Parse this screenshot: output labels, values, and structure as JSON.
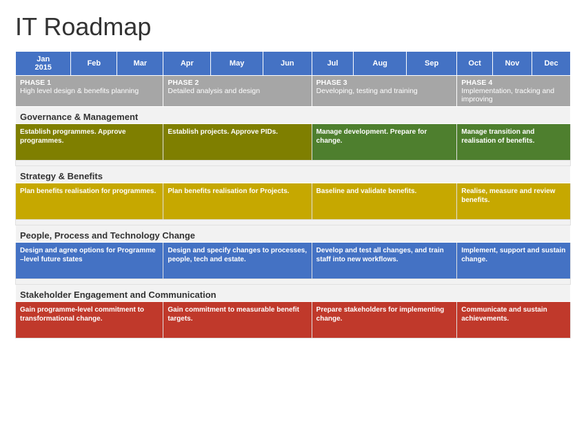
{
  "title": "IT Roadmap",
  "header": {
    "columns": [
      {
        "label": "Jan\n2015",
        "span": 1
      },
      {
        "label": "Feb",
        "span": 1
      },
      {
        "label": "Mar",
        "span": 1
      },
      {
        "label": "Apr",
        "span": 1
      },
      {
        "label": "May",
        "span": 1
      },
      {
        "label": "Jun",
        "span": 1
      },
      {
        "label": "Jul",
        "span": 1
      },
      {
        "label": "Aug",
        "span": 1
      },
      {
        "label": "Sep",
        "span": 1
      },
      {
        "label": "Oct",
        "span": 1
      },
      {
        "label": "Nov",
        "span": 1
      },
      {
        "label": "Dec",
        "span": 1
      }
    ]
  },
  "phases": [
    {
      "title": "PHASE 1",
      "desc": "High level design & benefits planning",
      "col_start": 1,
      "col_span": 3
    },
    {
      "title": "PHASE 2",
      "desc": "Detailed analysis and design",
      "col_start": 4,
      "col_span": 3
    },
    {
      "title": "PHASE 3",
      "desc": "Developing, testing and training",
      "col_start": 7,
      "col_span": 3
    },
    {
      "title": "PHASE 4",
      "desc": "Implementation, tracking and improving",
      "col_start": 10,
      "col_span": 3
    }
  ],
  "sections": [
    {
      "name": "Governance & Management",
      "tasks": [
        {
          "text": "Establish programmes. Approve programmes.",
          "color": "olive",
          "col_start": 1,
          "col_span": 3
        },
        {
          "text": "Establish projects. Approve PIDs.",
          "color": "olive",
          "col_start": 4,
          "col_span": 3
        },
        {
          "text": "Manage development. Prepare for change.",
          "color": "green",
          "col_start": 7,
          "col_span": 3
        },
        {
          "text": "Manage transition and realisation of benefits.",
          "color": "green",
          "col_start": 10,
          "col_span": 3
        }
      ]
    },
    {
      "name": "Strategy & Benefits",
      "tasks": [
        {
          "text": "Plan benefits realisation for programmes.",
          "color": "yellow",
          "col_start": 1,
          "col_span": 3
        },
        {
          "text": "Plan benefits realisation for Projects.",
          "color": "yellow",
          "col_start": 4,
          "col_span": 3
        },
        {
          "text": "Baseline and validate benefits.",
          "color": "yellow",
          "col_start": 7,
          "col_span": 3
        },
        {
          "text": "Realise, measure and review benefits.",
          "color": "yellow",
          "col_start": 10,
          "col_span": 3
        }
      ]
    },
    {
      "name": "People, Process and Technology Change",
      "tasks": [
        {
          "text": "Design and agree options for Programme –level future states",
          "color": "blue",
          "col_start": 1,
          "col_span": 3
        },
        {
          "text": "Design and specify changes to processes, people, tech and estate.",
          "color": "blue",
          "col_start": 4,
          "col_span": 3
        },
        {
          "text": "Develop and test all changes, and train staff into new workflows.",
          "color": "blue",
          "col_start": 7,
          "col_span": 3
        },
        {
          "text": "Implement, support and sustain change.",
          "color": "blue",
          "col_start": 10,
          "col_span": 3
        }
      ]
    },
    {
      "name": "Stakeholder Engagement and Communication",
      "tasks": [
        {
          "text": "Gain programme-level commitment to transformational change.",
          "color": "red",
          "col_start": 1,
          "col_span": 3
        },
        {
          "text": "Gain commitment to measurable benefit targets.",
          "color": "red",
          "col_start": 4,
          "col_span": 3
        },
        {
          "text": "Prepare stakeholders for implementing change.",
          "color": "red",
          "col_start": 7,
          "col_span": 3
        },
        {
          "text": "Communicate and sustain achievements.",
          "color": "red",
          "col_start": 10,
          "col_span": 3
        }
      ]
    }
  ]
}
